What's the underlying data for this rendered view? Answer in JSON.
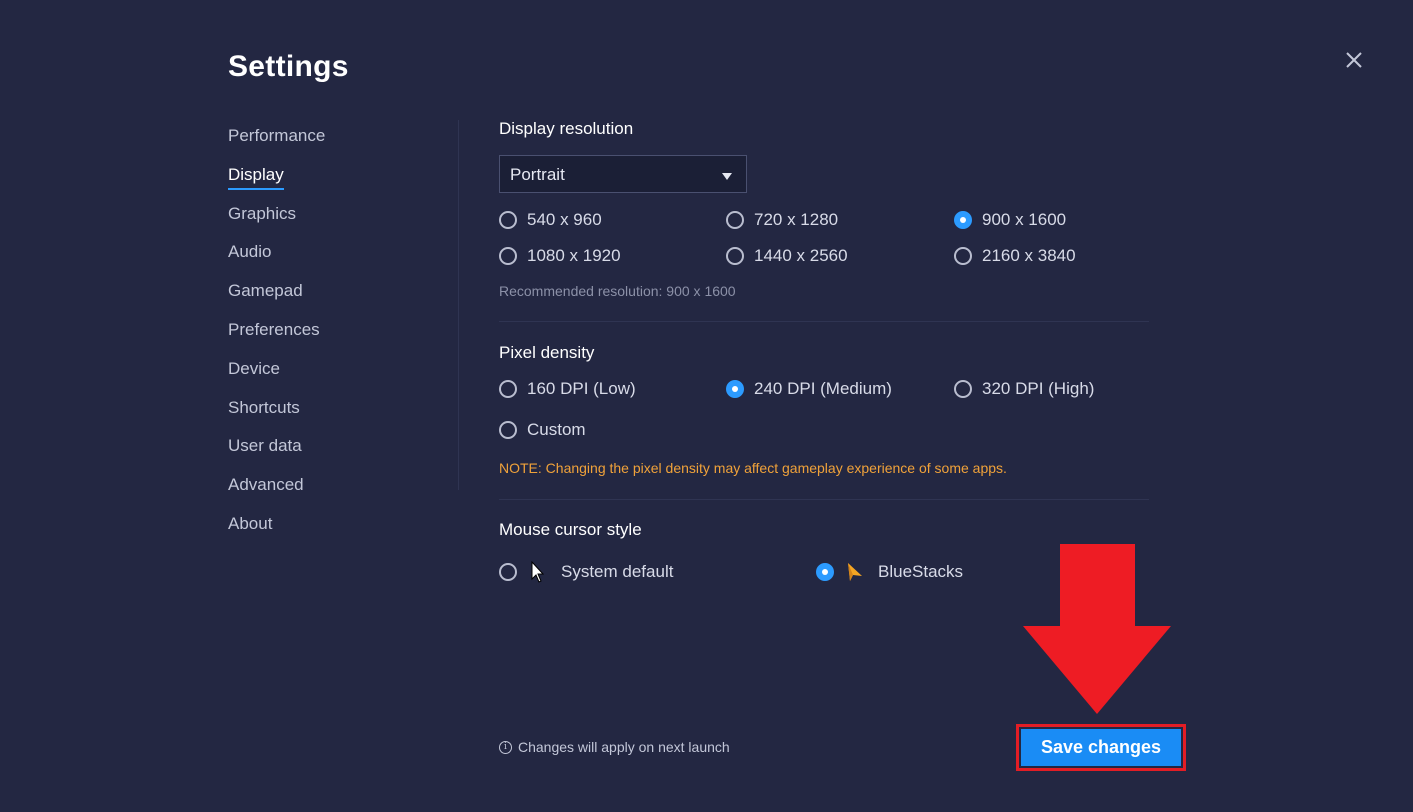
{
  "header": {
    "title": "Settings"
  },
  "sidebar": {
    "items": [
      {
        "label": "Performance",
        "active": false
      },
      {
        "label": "Display",
        "active": true
      },
      {
        "label": "Graphics",
        "active": false
      },
      {
        "label": "Audio",
        "active": false
      },
      {
        "label": "Gamepad",
        "active": false
      },
      {
        "label": "Preferences",
        "active": false
      },
      {
        "label": "Device",
        "active": false
      },
      {
        "label": "Shortcuts",
        "active": false
      },
      {
        "label": "User data",
        "active": false
      },
      {
        "label": "Advanced",
        "active": false
      },
      {
        "label": "About",
        "active": false
      }
    ]
  },
  "display_resolution": {
    "title": "Display resolution",
    "orientation": "Portrait",
    "options": [
      {
        "label": "540 x 960",
        "checked": false
      },
      {
        "label": "720 x 1280",
        "checked": false
      },
      {
        "label": "900 x 1600",
        "checked": true
      },
      {
        "label": "1080 x 1920",
        "checked": false
      },
      {
        "label": "1440 x 2560",
        "checked": false
      },
      {
        "label": "2160 x 3840",
        "checked": false
      }
    ],
    "recommended": "Recommended resolution: 900 x 1600"
  },
  "pixel_density": {
    "title": "Pixel density",
    "options": [
      {
        "label": "160 DPI (Low)",
        "checked": false
      },
      {
        "label": "240 DPI (Medium)",
        "checked": true
      },
      {
        "label": "320 DPI (High)",
        "checked": false
      },
      {
        "label": "Custom",
        "checked": false
      }
    ],
    "note": "NOTE: Changing the pixel density may affect gameplay experience of some apps."
  },
  "mouse_cursor": {
    "title": "Mouse cursor style",
    "options": [
      {
        "label": "System default",
        "checked": false,
        "icon": "system-cursor-icon"
      },
      {
        "label": "BlueStacks",
        "checked": true,
        "icon": "bluestacks-cursor-icon"
      }
    ]
  },
  "footer": {
    "info": "Changes will apply on next launch",
    "save_label": "Save changes"
  },
  "colors": {
    "background": "#232742",
    "accent": "#1a8cf5",
    "note": "#f0a23a",
    "highlight": "#e31d25"
  }
}
